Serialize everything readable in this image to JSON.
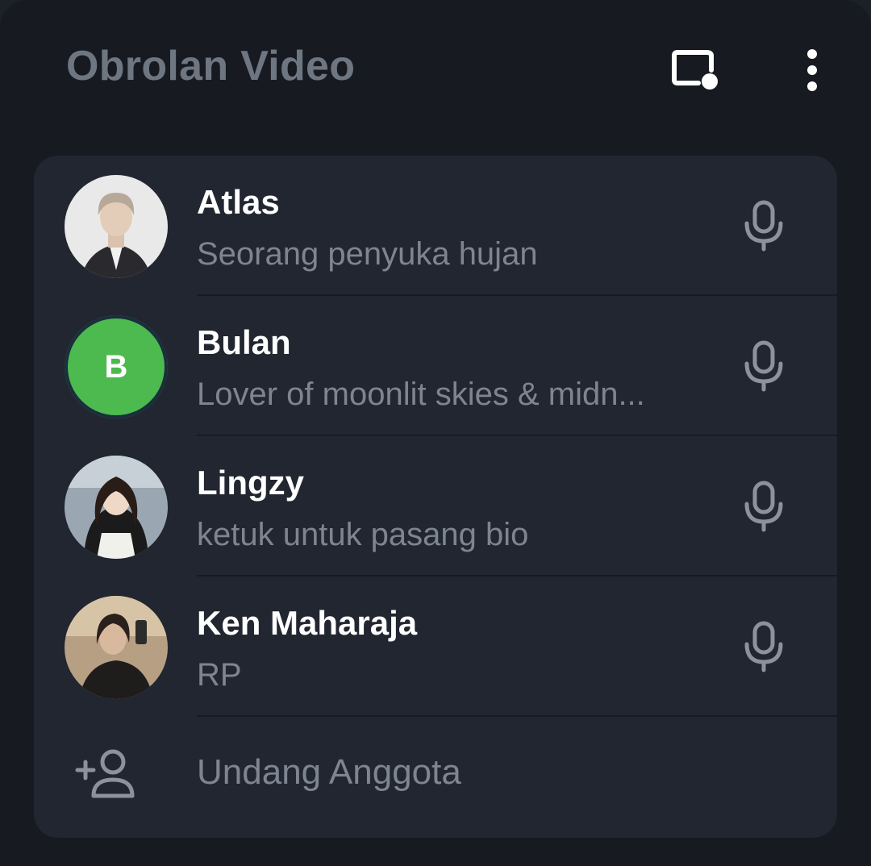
{
  "header": {
    "title": "Obrolan Video",
    "pip_icon": "picture-in-picture-icon",
    "more_icon": "more-vertical-icon"
  },
  "members": [
    {
      "name": "Atlas",
      "bio": "Seorang penyuka hujan",
      "avatar": "photo",
      "mic_icon": "microphone-icon"
    },
    {
      "name": "Bulan",
      "bio": "Lover of moonlit skies & midn...",
      "avatar_letter": "B",
      "avatar_color": "#4cba4e",
      "mic_icon": "microphone-icon"
    },
    {
      "name": "Lingzy",
      "bio": "ketuk untuk pasang bio",
      "avatar": "photo",
      "mic_icon": "microphone-icon"
    },
    {
      "name": "Ken Maharaja",
      "bio": "RP",
      "avatar": "photo",
      "mic_icon": "microphone-icon"
    }
  ],
  "invite": {
    "label": "Undang Anggota",
    "icon": "add-user-icon"
  },
  "colors": {
    "background": "#171b21",
    "panel": "#212630",
    "title_text": "#6e7681",
    "secondary_text": "#7d8590",
    "icon_gray": "#8b929c"
  }
}
